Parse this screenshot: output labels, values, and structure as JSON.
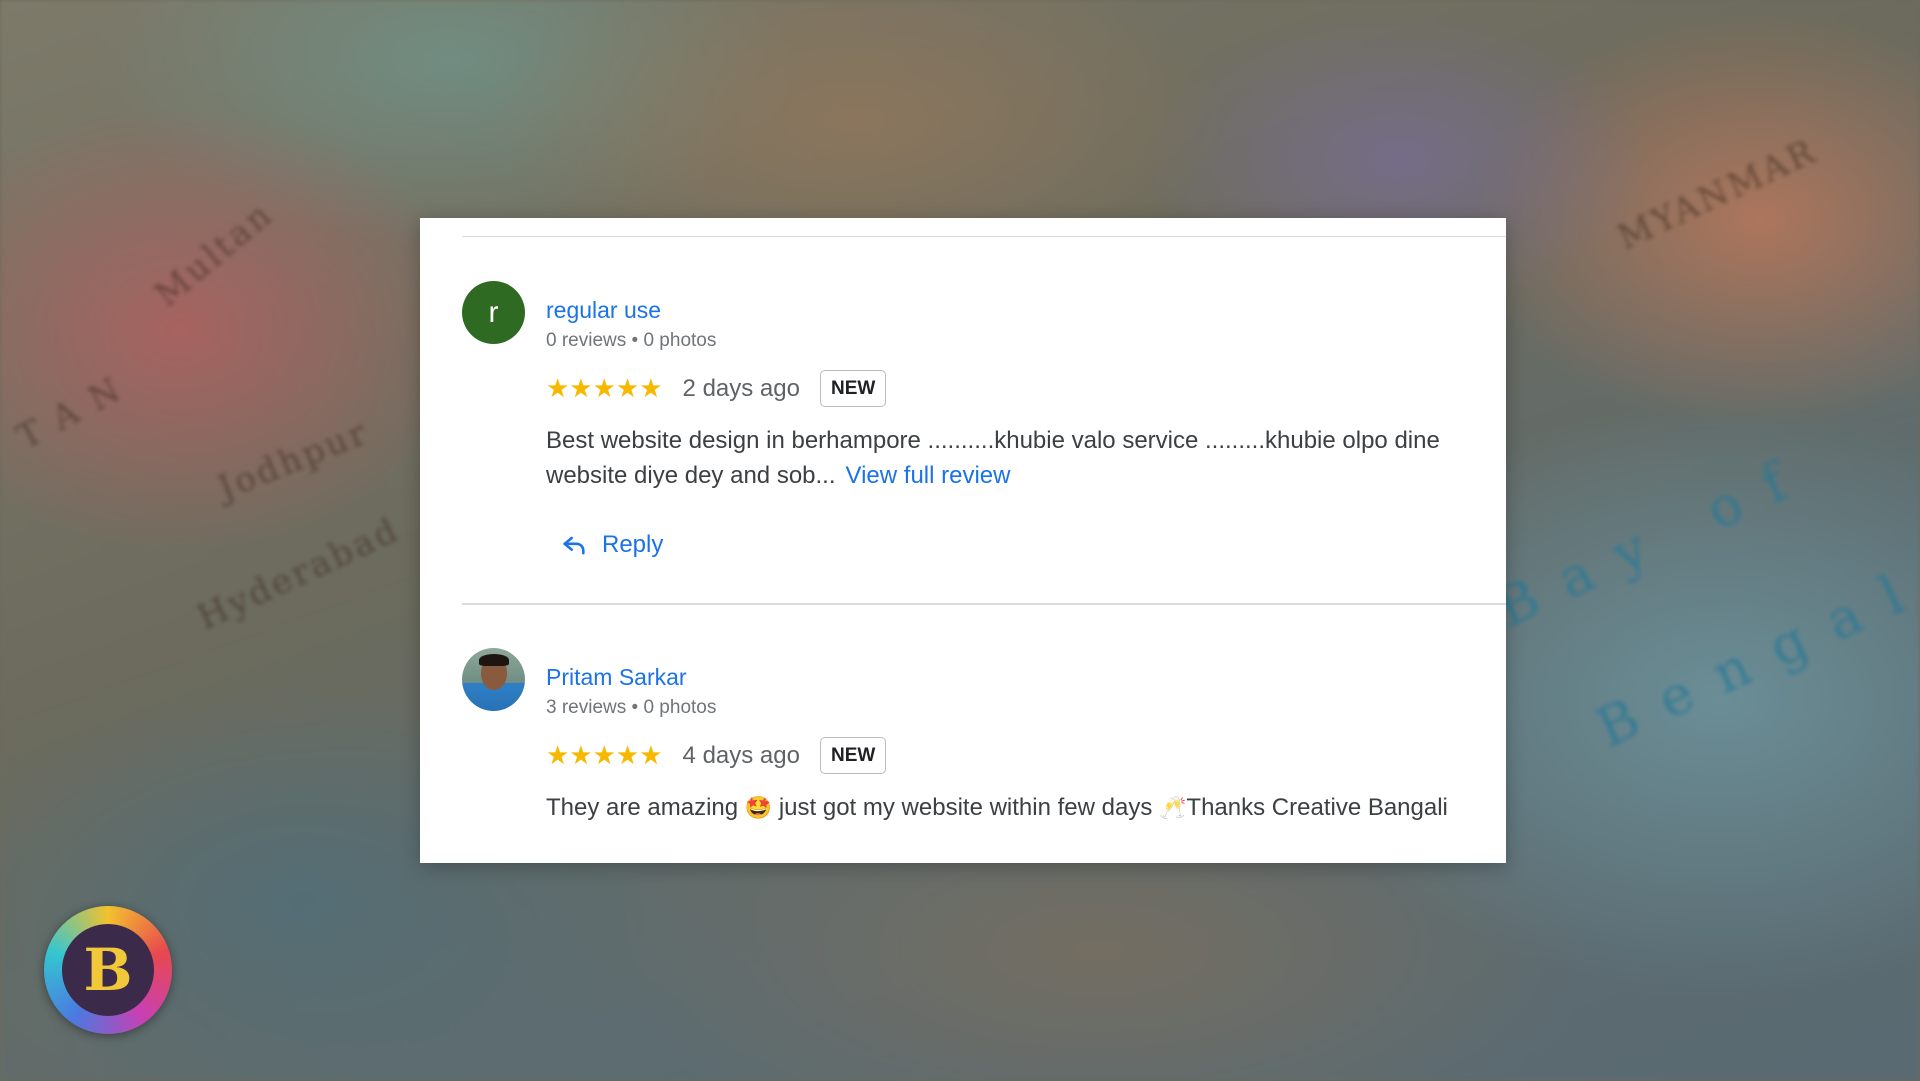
{
  "reviews": [
    {
      "avatar_letter": "r",
      "name": "regular use",
      "meta": "0 reviews • 0 photos",
      "stars": "★★★★★",
      "time": "2 days ago",
      "badge": "NEW",
      "text": "Best website design in berhampore ..........khubie valo service .........khubie olpo dine website diye dey and sob...",
      "view_full": "View full review",
      "reply": "Reply"
    },
    {
      "name": "Pritam Sarkar",
      "meta": "3 reviews • 0 photos",
      "stars": "★★★★★",
      "time": "4 days ago",
      "badge": "NEW",
      "text_part1": "They are amazing",
      "emoji1": "🤩",
      "text_part2": "just got my website within few days",
      "emoji2": "🥂",
      "text_part3": "Thanks Creative Bangali"
    }
  ],
  "logo_letter": "B"
}
